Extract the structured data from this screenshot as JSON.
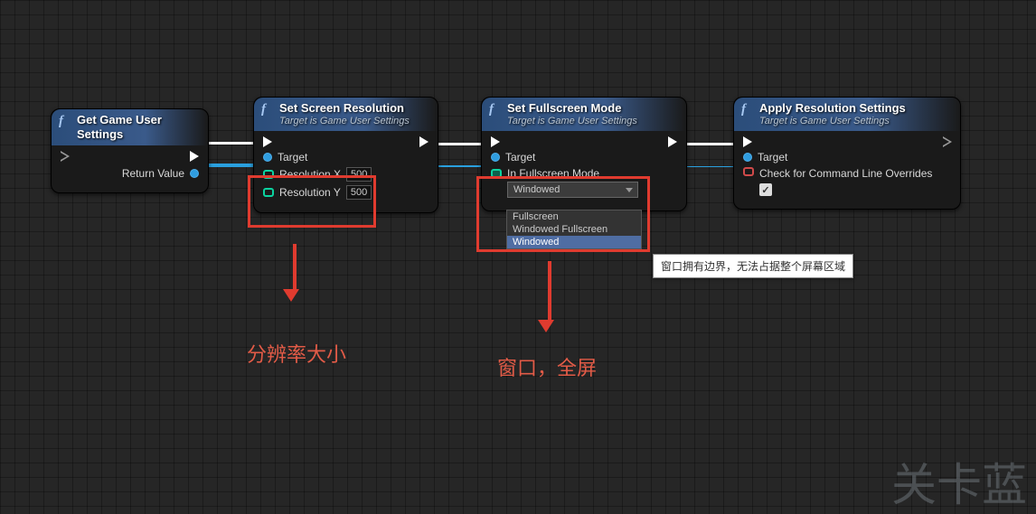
{
  "nodes": {
    "get": {
      "title": "Get Game User Settings",
      "return_label": "Return Value"
    },
    "setRes": {
      "title": "Set Screen Resolution",
      "subtitle": "Target is Game User Settings",
      "target_label": "Target",
      "resx_label": "Resolution X",
      "resx_value": "500",
      "resy_label": "Resolution Y",
      "resy_value": "500"
    },
    "setFull": {
      "title": "Set Fullscreen Mode",
      "subtitle": "Target is Game User Settings",
      "target_label": "Target",
      "mode_label": "In Fullscreen Mode",
      "mode_value": "Windowed",
      "options": [
        "Fullscreen",
        "Windowed Fullscreen",
        "Windowed"
      ]
    },
    "apply": {
      "title": "Apply Resolution Settings",
      "subtitle": "Target is Game User Settings",
      "target_label": "Target",
      "check_label": "Check for Command Line Overrides"
    }
  },
  "tooltip": "窗口拥有边界，无法占据整个屏幕区域",
  "annotations": {
    "res": "分辨率大小",
    "mode": "窗口，全屏"
  },
  "watermark": "关卡蓝"
}
